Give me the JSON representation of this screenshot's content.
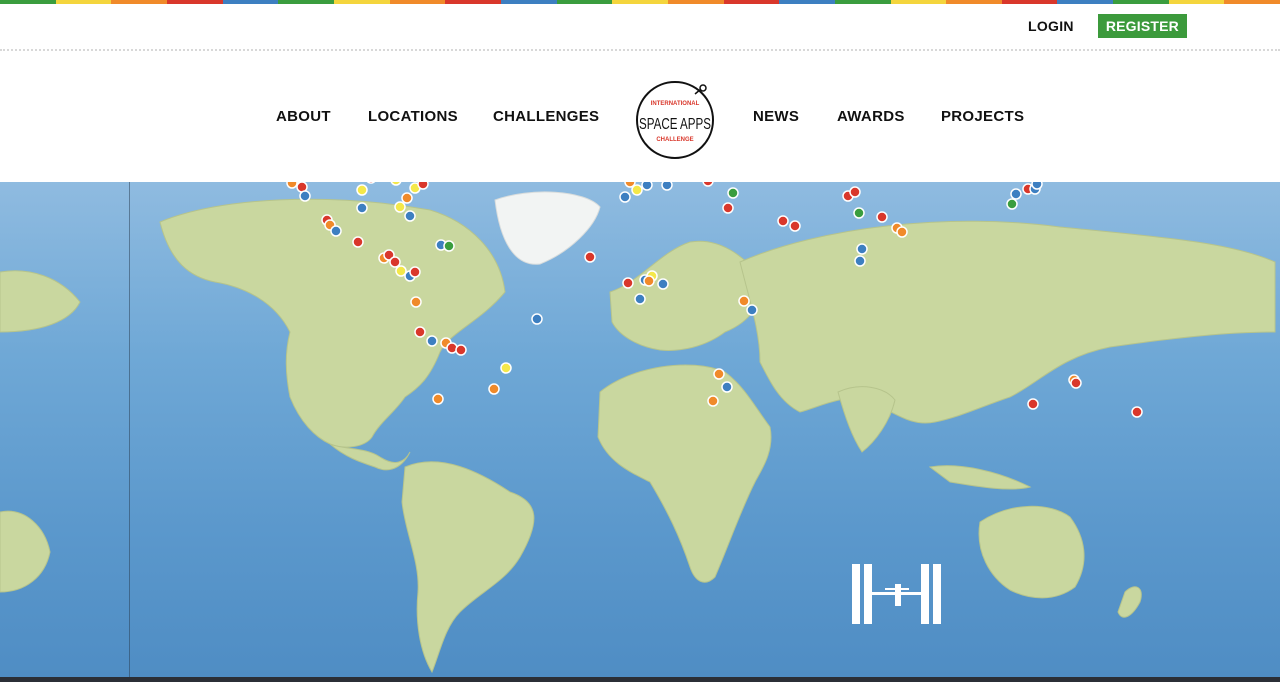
{
  "brand": {
    "stripe_colors": [
      "#3a9d3e",
      "#f4d53d",
      "#f08a2a",
      "#d9372b",
      "#3d7fc1",
      "#3a9d3e",
      "#f4d53d",
      "#f08a2a",
      "#d9372b",
      "#3d7fc1",
      "#3a9d3e",
      "#f4d53d",
      "#f08a2a",
      "#d9372b",
      "#3d7fc1",
      "#3a9d3e",
      "#f4d53d",
      "#f08a2a",
      "#d9372b",
      "#3d7fc1",
      "#3a9d3e",
      "#f4d53d",
      "#f08a2a"
    ],
    "logo_text_top": "INTERNATIONAL",
    "logo_text_main": "SPACE APPS",
    "logo_text_bottom": "CHALLENGE"
  },
  "auth": {
    "login_label": "LOGIN",
    "register_label": "REGISTER",
    "register_color": "#3c9a3c"
  },
  "nav": {
    "about": "ABOUT",
    "locations": "LOCATIONS",
    "challenges": "CHALLENGES",
    "news": "NEWS",
    "awards": "AWARDS",
    "projects": "PROJECTS"
  },
  "marker_colors": {
    "red": "#d9372b",
    "orange": "#f08a2a",
    "yellow": "#f4e84a",
    "green": "#3a9d3e",
    "blue": "#3d7fc1"
  }
}
